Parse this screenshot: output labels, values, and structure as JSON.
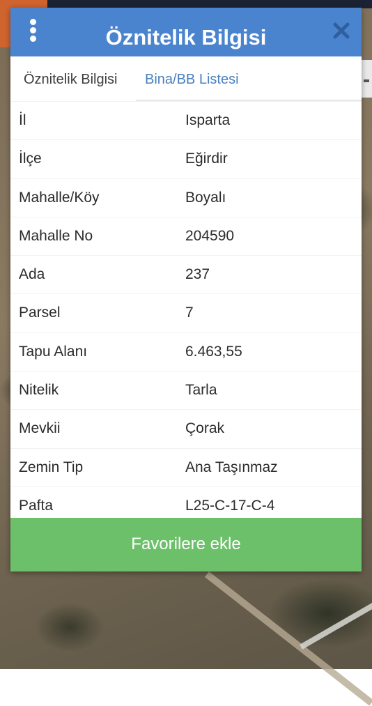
{
  "dialog": {
    "title": "Öznitelik Bilgisi",
    "menu_icon": "more-vertical-icon",
    "close_icon": "close-icon"
  },
  "tabs": [
    {
      "label": "Öznitelik Bilgisi",
      "active": true
    },
    {
      "label": "Bina/BB Listesi",
      "active": false
    }
  ],
  "attributes": [
    {
      "key": "İl",
      "value": "Isparta"
    },
    {
      "key": "İlçe",
      "value": "Eğirdir"
    },
    {
      "key": "Mahalle/Köy",
      "value": "Boyalı"
    },
    {
      "key": "Mahalle No",
      "value": "204590"
    },
    {
      "key": "Ada",
      "value": "237"
    },
    {
      "key": "Parsel",
      "value": "7"
    },
    {
      "key": "Tapu Alanı",
      "value": "6.463,55"
    },
    {
      "key": "Nitelik",
      "value": "Tarla"
    },
    {
      "key": "Mevkii",
      "value": "Çorak"
    },
    {
      "key": "Zemin Tip",
      "value": "Ana Taşınmaz"
    },
    {
      "key": "Pafta",
      "value": "L25-C-17-C-4"
    }
  ],
  "actions": {
    "favorite_label": "Favorilere ekle"
  },
  "colors": {
    "header": "#4a84ce",
    "active_tab_text": "#3d3d3d",
    "inactive_tab_text": "#4a80bd",
    "favorite_button": "#6cc06a"
  }
}
